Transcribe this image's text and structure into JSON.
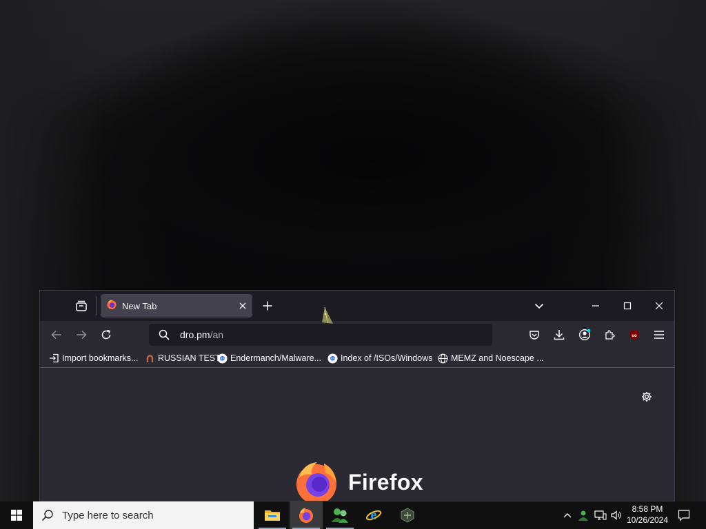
{
  "browser": {
    "tab": {
      "title": "New Tab"
    },
    "url": {
      "domain": "dro.pm",
      "path": "/an"
    },
    "bookmarks": [
      {
        "label": "Import bookmarks...",
        "icon": "import-icon"
      },
      {
        "label": "RUSSIAN TEST",
        "icon": "horseshoe-favicon-icon"
      },
      {
        "label": "Endermanch/Malware...",
        "icon": "google-favicon-icon"
      },
      {
        "label": "Index of /ISOs/Windows",
        "icon": "google-favicon-icon"
      },
      {
        "label": "MEMZ and Noescape ...",
        "icon": "globe-icon"
      }
    ],
    "newtab": {
      "brand": "Firefox"
    }
  },
  "taskbar": {
    "search_placeholder": "Type here to search",
    "apps": [
      "file-explorer-icon",
      "firefox-icon",
      "people-app-icon",
      "internet-explorer-icon",
      "security-app-icon"
    ],
    "clock": {
      "time": "8:58 PM",
      "date": "10/26/2024"
    }
  },
  "colors": {
    "tabstrip": "#1c1b22",
    "toolbar": "#2b2a33",
    "active_tab": "#42414d",
    "taskbar": "#101011",
    "search_box": "#f3f3f3"
  }
}
